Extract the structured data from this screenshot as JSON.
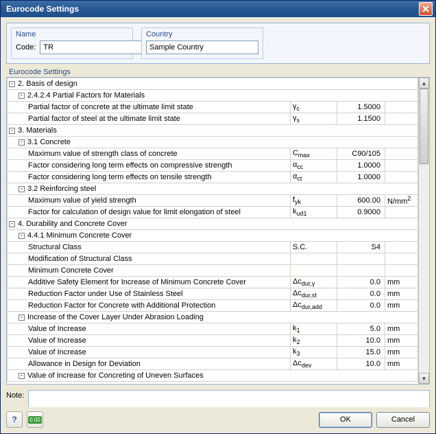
{
  "window": {
    "title": "Eurocode Settings"
  },
  "header": {
    "name_group": "Name",
    "code_label": "Code:",
    "code_value": "TR",
    "country_group": "Country",
    "country_value": "Sample Country"
  },
  "section_title": "Eurocode Settings",
  "rows": [
    {
      "indent": 0,
      "toggle": "-",
      "label": "2. Basis of design",
      "sym": "",
      "val": "",
      "unit": ""
    },
    {
      "indent": 1,
      "toggle": "-",
      "label": "2.4.2.4 Partial Factors for Materials",
      "sym": "",
      "val": "",
      "unit": ""
    },
    {
      "indent": 2,
      "toggle": "",
      "label": "Partial factor of concrete at the ultimate limit state",
      "sym": "γ<sub>c</sub>",
      "val": "1.5000",
      "unit": ""
    },
    {
      "indent": 2,
      "toggle": "",
      "label": "Partial factor of steel at the ultimate limit state",
      "sym": "γ<sub>s</sub>",
      "val": "1.1500",
      "unit": ""
    },
    {
      "indent": 0,
      "toggle": "-",
      "label": "3. Materials",
      "sym": "",
      "val": "",
      "unit": ""
    },
    {
      "indent": 1,
      "toggle": "-",
      "label": "3.1 Concrete",
      "sym": "",
      "val": "",
      "unit": ""
    },
    {
      "indent": 2,
      "toggle": "",
      "label": "Maximum value of strength class of concrete",
      "sym": "C<sub>max</sub>",
      "val": "C90/105",
      "unit": ""
    },
    {
      "indent": 2,
      "toggle": "",
      "label": "Factor considering long term effects on compressive strength",
      "sym": "α<sub>cc</sub>",
      "val": "1.0000",
      "unit": ""
    },
    {
      "indent": 2,
      "toggle": "",
      "label": "Factor considering long term effects on tensile strength",
      "sym": "α<sub>ct</sub>",
      "val": "1.0000",
      "unit": ""
    },
    {
      "indent": 1,
      "toggle": "-",
      "label": "3.2 Reinforcing steel",
      "sym": "",
      "val": "",
      "unit": ""
    },
    {
      "indent": 2,
      "toggle": "",
      "label": "Maximum value of yield strength",
      "sym": "f<sub>yk</sub>",
      "val": "600.00",
      "unit": "N/mm<sup>2</sup>"
    },
    {
      "indent": 2,
      "toggle": "",
      "label": "Factor for calculation of design value for limit elongation of steel",
      "sym": "k<sub>ud1</sub>",
      "val": "0.9000",
      "unit": ""
    },
    {
      "indent": 0,
      "toggle": "-",
      "label": "4. Durability and Concrete Cover",
      "sym": "",
      "val": "",
      "unit": ""
    },
    {
      "indent": 1,
      "toggle": "-",
      "label": "4.4.1 Minimum Concrete Cover",
      "sym": "",
      "val": "",
      "unit": ""
    },
    {
      "indent": 2,
      "toggle": "",
      "label": "Structural Class",
      "sym": "S.C.",
      "val": "S4",
      "unit": ""
    },
    {
      "indent": 2,
      "toggle": "",
      "label": "Modification of Structural Class",
      "sym": "",
      "val": "",
      "unit": ""
    },
    {
      "indent": 2,
      "toggle": "",
      "label": "Minimum Concrete Cover",
      "sym": "",
      "val": "",
      "unit": ""
    },
    {
      "indent": 2,
      "toggle": "",
      "label": "Additive Safety Element for Increase of Minimum Concrete Cover",
      "sym": "Δc<sub>dur,γ</sub>",
      "val": "0.0",
      "unit": "mm"
    },
    {
      "indent": 2,
      "toggle": "",
      "label": "Reduction Factor under Use of Stainless Steel",
      "sym": "Δc<sub>dur,st</sub>",
      "val": "0.0",
      "unit": "mm"
    },
    {
      "indent": 2,
      "toggle": "",
      "label": "Reduction Factor for Concrete with Additional Protection",
      "sym": "Δc<sub>dur,add</sub>",
      "val": "0.0",
      "unit": "mm"
    },
    {
      "indent": 1,
      "toggle": "-",
      "label": "Increase of the Cover Layer Under Abrasion Loading",
      "sym": "",
      "val": "",
      "unit": ""
    },
    {
      "indent": 2,
      "toggle": "",
      "label": "Value of Increase",
      "sym": "k<sub>1</sub>",
      "val": "5.0",
      "unit": "mm"
    },
    {
      "indent": 2,
      "toggle": "",
      "label": "Value of Increase",
      "sym": "k<sub>2</sub>",
      "val": "10.0",
      "unit": "mm"
    },
    {
      "indent": 2,
      "toggle": "",
      "label": "Value of Increase",
      "sym": "k<sub>3</sub>",
      "val": "15.0",
      "unit": "mm"
    },
    {
      "indent": 2,
      "toggle": "",
      "label": "Allowance in Design for Deviation",
      "sym": "Δc<sub>dev</sub>",
      "val": "10.0",
      "unit": "mm"
    },
    {
      "indent": 1,
      "toggle": "-",
      "label": "Value of Increase for Concreting of Uneven Surfaces",
      "sym": "",
      "val": "",
      "unit": ""
    }
  ],
  "note_label": "Note:",
  "buttons": {
    "ok": "OK",
    "cancel": "Cancel"
  }
}
